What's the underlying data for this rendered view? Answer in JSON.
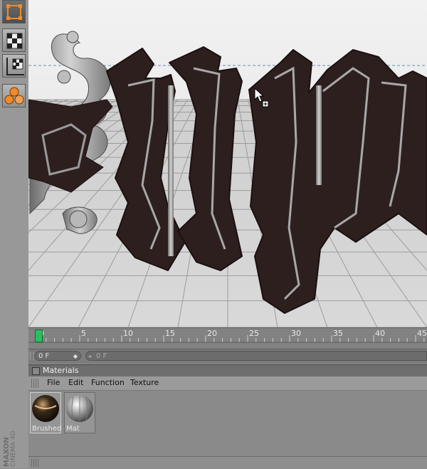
{
  "left_toolbar": {
    "tools": [
      {
        "name": "object-mode-icon"
      },
      {
        "name": "texture-mode-icon"
      },
      {
        "name": "texture-axis-icon"
      },
      {
        "name": "sculpt-paint-icon"
      }
    ],
    "brand_line1": "MAXON",
    "brand_line2": "CINEMA 4D"
  },
  "viewport": {
    "background_color": "#e6e6e6",
    "letter_color": "#2e1f1f",
    "inlay_color": "#9a9a9a"
  },
  "timeline": {
    "current_frame": 0,
    "ticks": [
      "0",
      "5",
      "10",
      "15",
      "20",
      "25",
      "30",
      "35",
      "40",
      "45"
    ]
  },
  "frame_controls": {
    "start_value": "0 F",
    "end_value": "0 F"
  },
  "materials_panel": {
    "title": "Materials",
    "menu": [
      "File",
      "Edit",
      "Function",
      "Texture"
    ],
    "materials": [
      {
        "label": "Brushed",
        "selected": true
      },
      {
        "label": "Mat",
        "selected": false
      }
    ]
  }
}
